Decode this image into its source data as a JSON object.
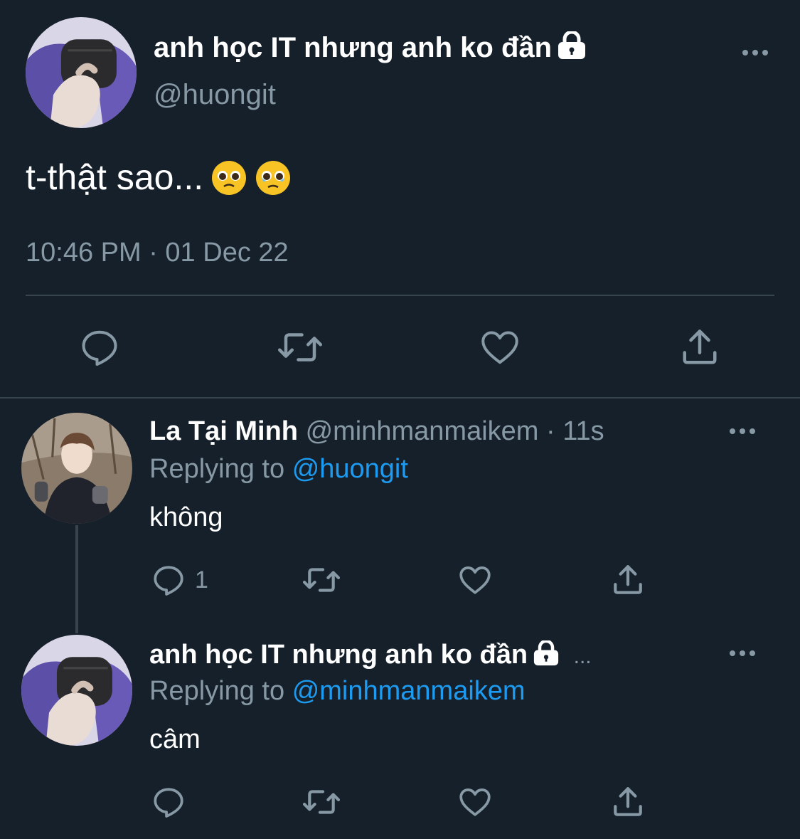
{
  "main_tweet": {
    "display_name": "anh học IT nhưng anh ko đần",
    "handle": "@huongit",
    "text": "t-thật sao...",
    "timestamp": "10:46 PM · 01 Dec 22",
    "protected": true,
    "emojis": [
      "pleading-face-icon",
      "face-holding-back-tears-icon"
    ],
    "actions": [
      "reply-icon",
      "retweet-icon",
      "like-icon",
      "share-icon"
    ]
  },
  "reply1": {
    "display_name": "La Tại Minh",
    "handle": "@minhmanmaikem",
    "time": "· 11s",
    "replying_prefix": "Replying to",
    "replying_to": "@huongit",
    "text": "không",
    "reply_count": "1"
  },
  "reply2": {
    "display_name": "anh học IT nhưng anh ko đần",
    "protected": true,
    "overflow": "...",
    "replying_prefix": "Replying to",
    "replying_to": "@minhmanmaikem",
    "text": "câm"
  },
  "colors": {
    "background": "#15202b",
    "text": "#ffffff",
    "secondary": "#8899a6",
    "accent": "#1d9bf0",
    "divider": "#38444d"
  }
}
